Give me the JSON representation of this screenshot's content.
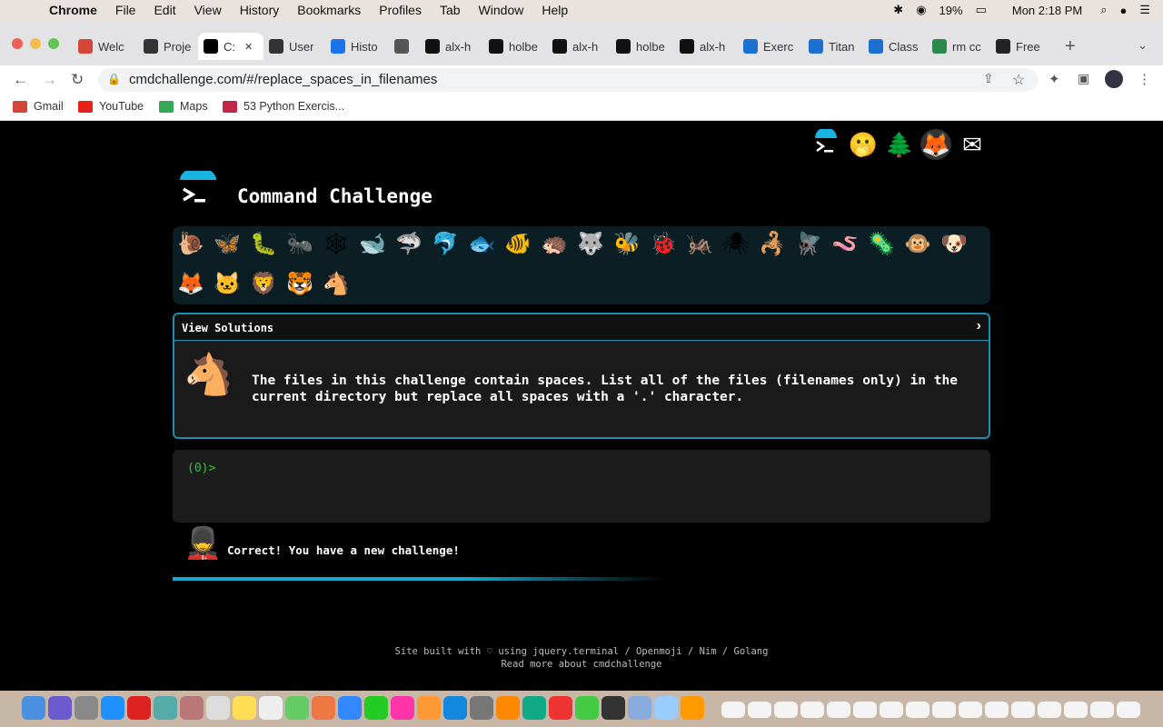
{
  "menubar": {
    "app": "Chrome",
    "items": [
      "File",
      "Edit",
      "View",
      "History",
      "Bookmarks",
      "Profiles",
      "Tab",
      "Window",
      "Help"
    ],
    "battery": "19%",
    "clock": "Mon 2:18 PM"
  },
  "tabs": [
    {
      "label": "Welc",
      "icon": "gmail-icon",
      "color": "#d44638"
    },
    {
      "label": "Proje",
      "icon": "alx-icon",
      "color": "#333333"
    },
    {
      "label": "C:",
      "icon": "terminal-icon",
      "color": "#000000"
    },
    {
      "label": "User",
      "icon": "alx-icon",
      "color": "#333333"
    },
    {
      "label": "Histo",
      "icon": "history-icon",
      "color": "#1a73e8"
    },
    {
      "label": "",
      "icon": "circle-icon",
      "color": "#555555"
    },
    {
      "label": "alx-h",
      "icon": "github-icon",
      "color": "#111111"
    },
    {
      "label": "holbe",
      "icon": "github-icon",
      "color": "#111111"
    },
    {
      "label": "alx-h",
      "icon": "github-icon",
      "color": "#111111"
    },
    {
      "label": "holbe",
      "icon": "github-icon",
      "color": "#111111"
    },
    {
      "label": "alx-h",
      "icon": "github-icon",
      "color": "#111111"
    },
    {
      "label": "Exerc",
      "icon": "k-icon",
      "color": "#1a6fd0"
    },
    {
      "label": "Titan",
      "icon": "k-icon",
      "color": "#1a6fd0"
    },
    {
      "label": "Class",
      "icon": "square-icon",
      "color": "#1a6fd0"
    },
    {
      "label": "rm cc",
      "icon": "link-icon",
      "color": "#2a8a4a"
    },
    {
      "label": "Free",
      "icon": "circle-icon",
      "color": "#222222"
    }
  ],
  "address": {
    "url": "cmdchallenge.com/#/replace_spaces_in_filenames"
  },
  "bookmarks": [
    {
      "label": "Gmail",
      "color": "#d44638"
    },
    {
      "label": "YouTube",
      "color": "#e62117"
    },
    {
      "label": "Maps",
      "color": "#34a853"
    },
    {
      "label": "53 Python Exercis...",
      "color": "#c0264a"
    }
  ],
  "page": {
    "title": "Command Challenge",
    "top_icons": [
      "💬",
      "🫢",
      "🌲",
      "🦊",
      "✉"
    ],
    "animals": [
      "🐌",
      "🦋",
      "🐛",
      "🐜",
      "🕸",
      "🐋",
      "🦈",
      "🐬",
      "🐟",
      "🐠",
      "🦔",
      "🐺",
      "🐝",
      "🐞",
      "🦗",
      "🕷",
      "🦂",
      "🪰",
      "🪱",
      "🦠",
      "🐵",
      "🐶",
      "🦊",
      "🐱",
      "🦁",
      "🐯",
      "🐴"
    ],
    "solutions_label": "View Solutions",
    "challenge_icon": "🐴",
    "challenge_text": "The files in this challenge contain spaces. List all of the files (filenames only) in the current directory but replace all spaces with a '.' character.",
    "prompt": "(0)>",
    "guard_icon": "💂",
    "result_text": "Correct! You have a new challenge!",
    "progress": 0.6,
    "footer_line1": "Site built with ♡ using jquery.terminal / Openmoji / Nim / Golang",
    "footer_line2": "Read more about cmdchallenge"
  }
}
